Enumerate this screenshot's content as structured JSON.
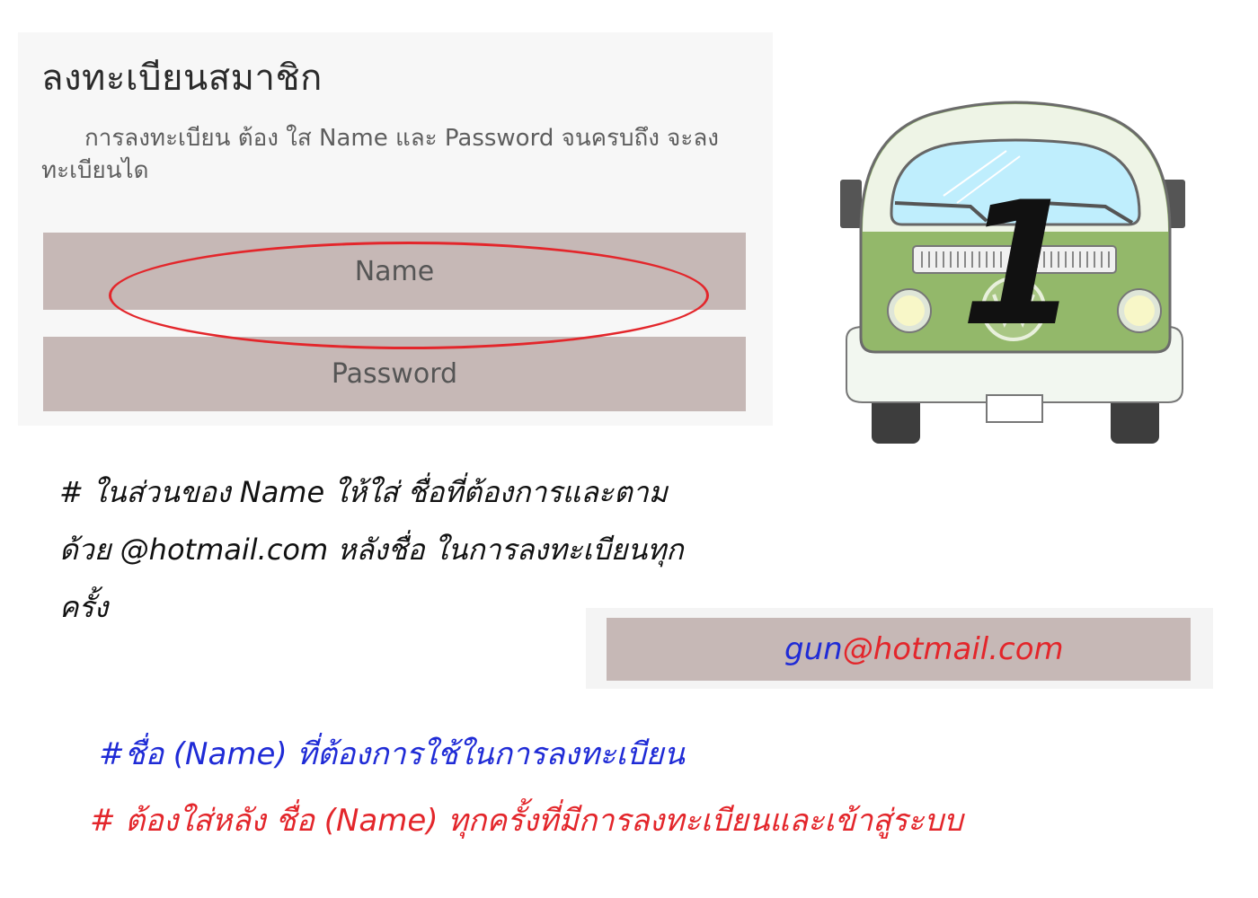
{
  "form": {
    "title": "ลงทะเบียนสมาชิก",
    "description": "การลงทะเบียน ต้อง ใส Name และ Password จนครบถึง จะลงทะเบียนได",
    "name_placeholder": "Name",
    "password_placeholder": "Password"
  },
  "notes": {
    "name_instruction": "# ในส่วนของ Name ให้ใส่ ชื่อที่ต้องการและตาม ด้วย @hotmail.com หลังชื่อ ในการลงทะเบียนทุก ครั้ง",
    "name_hint": "#ชื่อ (Name) ที่ต้องการใช้ในการลงทะเบียน",
    "domain_hint": "# ต้องใส่หลัง ชื่อ (Name) ทุกครั้งที่มีการลงทะเบียนและเข้าสู่ระบบ"
  },
  "example": {
    "user": "gun",
    "domain": "@hotmail.com"
  },
  "step": {
    "number": "1",
    "icon": "van-icon"
  },
  "colors": {
    "field_bg": "#c6b8b6",
    "highlight": "#e3262b",
    "blue_text": "#1f2bd6",
    "van_body": "#93b86a"
  }
}
